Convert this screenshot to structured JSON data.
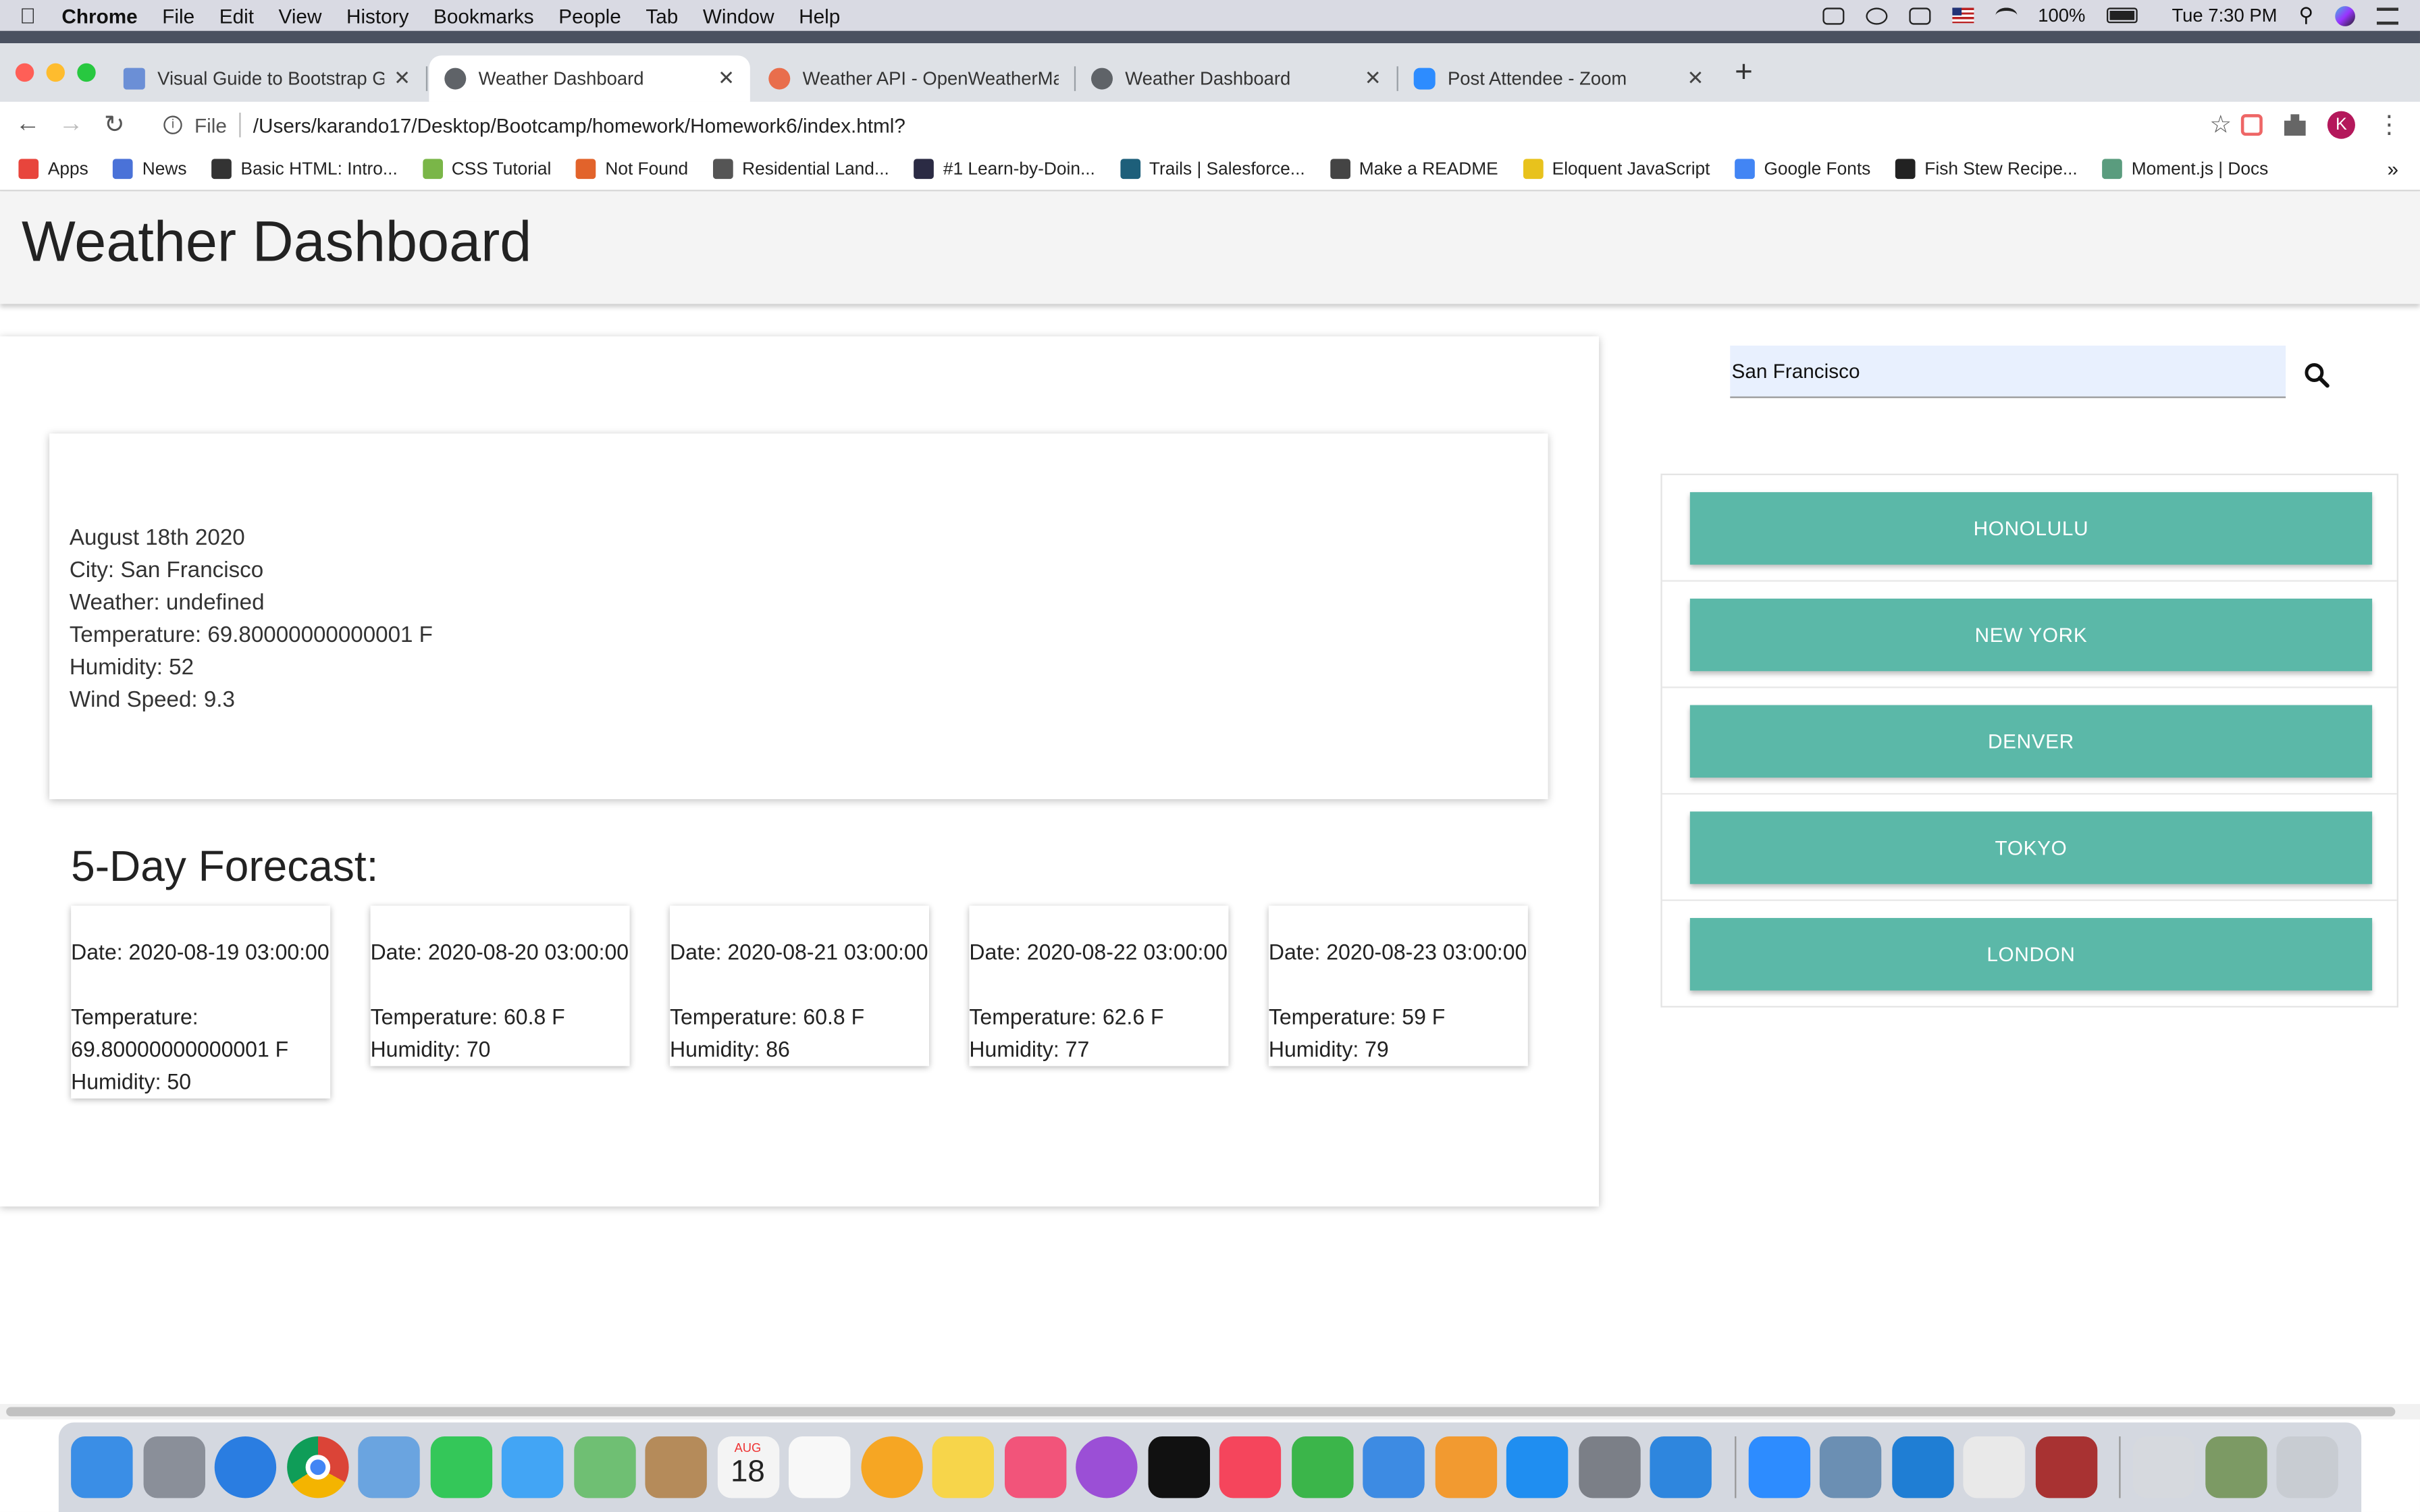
{
  "menubar": {
    "app": "Chrome",
    "items": [
      "File",
      "Edit",
      "View",
      "History",
      "Bookmarks",
      "People",
      "Tab",
      "Window",
      "Help"
    ],
    "battery": "100%",
    "clock": "Tue 7:30 PM"
  },
  "tabs": [
    {
      "title": "Visual Guide to Bootstrap Grid",
      "favicon_color": "#6b8fd6"
    },
    {
      "title": "Weather Dashboard",
      "favicon_color": "#5f6368",
      "active": true
    },
    {
      "title": "Weather API - OpenWeatherMap",
      "favicon_color": "#e96e4c"
    },
    {
      "title": "Weather Dashboard",
      "favicon_color": "#5f6368"
    },
    {
      "title": "Post Attendee - Zoom",
      "favicon_color": "#2d8cff"
    }
  ],
  "address": {
    "scheme": "File",
    "url": "/Users/karando17/Desktop/Bootcamp/homework/Homework6/index.html?"
  },
  "profile_initial": "K",
  "bookmarks": [
    {
      "label": "Apps",
      "color": "#e8453c"
    },
    {
      "label": "News",
      "color": "#4a72d8"
    },
    {
      "label": "Basic HTML: Intro...",
      "color": "#333333"
    },
    {
      "label": "CSS Tutorial",
      "color": "#7ab648"
    },
    {
      "label": "Not Found",
      "color": "#e2632b"
    },
    {
      "label": "Residential Land...",
      "color": "#555555"
    },
    {
      "label": "#1 Learn-by-Doin...",
      "color": "#2b2b44"
    },
    {
      "label": "Trails | Salesforce...",
      "color": "#1d5f7a"
    },
    {
      "label": "Make a README",
      "color": "#444444"
    },
    {
      "label": "Eloquent JavaScript",
      "color": "#e8c21c"
    },
    {
      "label": "Google Fonts",
      "color": "#4285f4"
    },
    {
      "label": "Fish Stew Recipe...",
      "color": "#222222"
    },
    {
      "label": "Moment.js | Docs",
      "color": "#5a9c7e"
    }
  ],
  "page": {
    "title": "Weather Dashboard",
    "search_value": "San Francisco",
    "current": {
      "date": "August 18th 2020",
      "city": "City: San Francisco",
      "weather": "Weather: undefined",
      "temperature": "Temperature: 69.80000000000001 F",
      "humidity": "Humidity: 52",
      "wind": "Wind Speed: 9.3"
    },
    "forecast_title": "5-Day Forecast:",
    "forecast": [
      {
        "date": "Date: 2020-08-19 03:00:00",
        "temp": "Temperature: 69.80000000000001 F",
        "humidity": "Humidity: 50"
      },
      {
        "date": "Date: 2020-08-20 03:00:00",
        "temp": "Temperature: 60.8 F",
        "humidity": "Humidity: 70"
      },
      {
        "date": "Date: 2020-08-21 03:00:00",
        "temp": "Temperature: 60.8 F",
        "humidity": "Humidity: 86"
      },
      {
        "date": "Date: 2020-08-22 03:00:00",
        "temp": "Temperature: 62.6 F",
        "humidity": "Humidity: 77"
      },
      {
        "date": "Date: 2020-08-23 03:00:00",
        "temp": "Temperature: 59 F",
        "humidity": "Humidity: 79"
      }
    ],
    "cities": [
      "HONOLULU",
      "NEW YORK",
      "DENVER",
      "TOKYO",
      "LONDON"
    ],
    "accent_color": "#5bb8a8"
  },
  "dock": {
    "apps": [
      {
        "name": "finder-icon",
        "color": "#3a8ee6"
      },
      {
        "name": "launchpad-icon",
        "color": "#8a8f99"
      },
      {
        "name": "safari-icon",
        "color": "#2a7de1"
      },
      {
        "name": "chrome-icon",
        "color": "#db4437"
      },
      {
        "name": "mail-icon",
        "color": "#6aa4e0"
      },
      {
        "name": "facetime-icon",
        "color": "#34c759"
      },
      {
        "name": "messages-icon",
        "color": "#42a5f5"
      },
      {
        "name": "maps-icon",
        "color": "#6fbf73"
      },
      {
        "name": "contacts-icon",
        "color": "#b58b5a"
      },
      {
        "name": "calendar-icon",
        "color": "#f4f4f4"
      },
      {
        "name": "reminders-icon",
        "color": "#f8f8f8"
      },
      {
        "name": "photos-icon",
        "color": "#f6a623"
      },
      {
        "name": "notes-icon",
        "color": "#f7d54a"
      },
      {
        "name": "music-icon",
        "color": "#f2547a"
      },
      {
        "name": "podcasts-icon",
        "color": "#9b4fd6"
      },
      {
        "name": "tv-icon",
        "color": "#111111"
      },
      {
        "name": "news-icon",
        "color": "#f5455c"
      },
      {
        "name": "numbers-icon",
        "color": "#3bb54a"
      },
      {
        "name": "keynote-icon",
        "color": "#3d8be3"
      },
      {
        "name": "pages-icon",
        "color": "#f29a30"
      },
      {
        "name": "app-store-icon",
        "color": "#1f8ef1"
      },
      {
        "name": "system-preferences-icon",
        "color": "#7b7f87"
      },
      {
        "name": "vectr-icon",
        "color": "#2e86de"
      },
      {
        "name": "zoom-icon",
        "color": "#2d8cff"
      },
      {
        "name": "preview-icon",
        "color": "#6b8fb3"
      },
      {
        "name": "vscode-icon",
        "color": "#1f7ed4"
      },
      {
        "name": "slack-icon",
        "color": "#e9e9e9"
      },
      {
        "name": "dictionary-icon",
        "color": "#a83232"
      },
      {
        "name": "downloads-icon",
        "color": "#d6d9de"
      },
      {
        "name": "image-stack-icon",
        "color": "#7c9a64"
      },
      {
        "name": "trash-icon",
        "color": "#c8ccd2"
      }
    ],
    "calendar_month": "AUG",
    "calendar_day": "18"
  }
}
